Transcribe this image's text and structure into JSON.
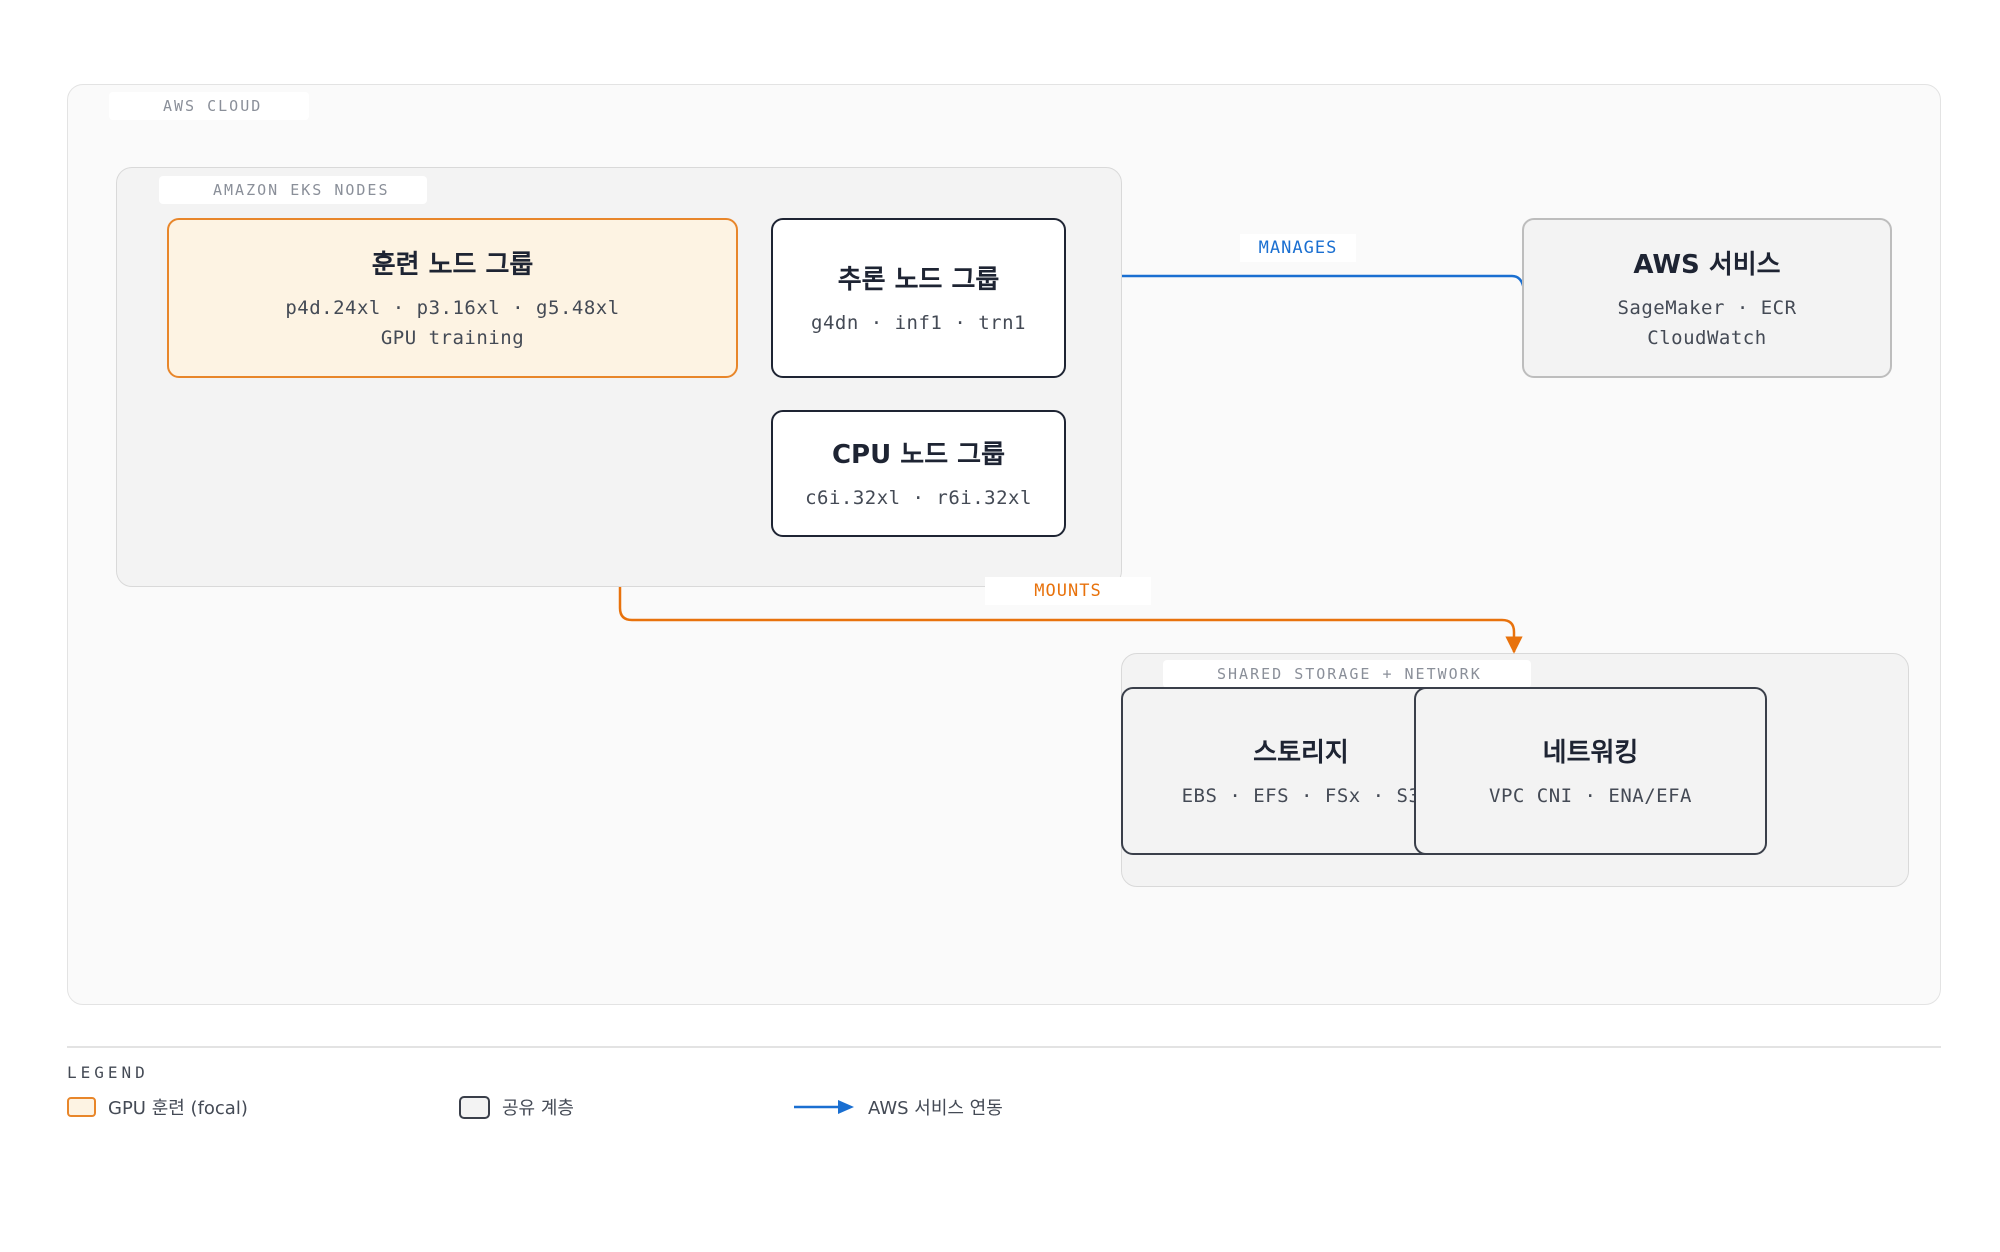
{
  "regions": {
    "cloud": {
      "label": "AWS CLOUD"
    },
    "eks": {
      "label": "AMAZON EKS NODES"
    },
    "storage": {
      "label": "SHARED STORAGE + NETWORK"
    }
  },
  "nodes": {
    "training": {
      "title": "훈련 노드 그룹",
      "lines": [
        "p4d.24xl · p3.16xl · g5.48xl",
        "GPU training"
      ]
    },
    "inference": {
      "title": "추론 노드 그룹",
      "lines": [
        "g4dn · inf1 · trn1"
      ]
    },
    "cpu": {
      "title": "CPU 노드 그룹",
      "lines": [
        "c6i.32xl · r6i.32xl"
      ]
    },
    "aws_services": {
      "title": "AWS 서비스",
      "lines": [
        "SageMaker · ECR",
        "CloudWatch"
      ]
    },
    "storage": {
      "title": "스토리지",
      "lines": [
        "EBS · EFS · FSx · S3"
      ]
    },
    "networking": {
      "title": "네트워킹",
      "lines": [
        "VPC CNI · ENA/EFA"
      ]
    }
  },
  "edges": {
    "manages": {
      "label": "MANAGES",
      "color": "#1a6fd1"
    },
    "mounts": {
      "label": "MOUNTS",
      "color": "#e8720c"
    }
  },
  "legend": {
    "title": "LEGEND",
    "items": [
      {
        "label": "GPU 훈련 (focal)",
        "icon": "orange-box-swatch"
      },
      {
        "label": "공유 계층",
        "icon": "gray-box-swatch"
      },
      {
        "label": "AWS 서비스 연동",
        "icon": "blue-arrow"
      }
    ]
  },
  "colors": {
    "focal_border": "#e8862a",
    "focal_fill": "#fdf3e3",
    "node_border": "#1e2433",
    "aws_blue": "#1a6fd1",
    "accent_orange": "#e8720c"
  }
}
